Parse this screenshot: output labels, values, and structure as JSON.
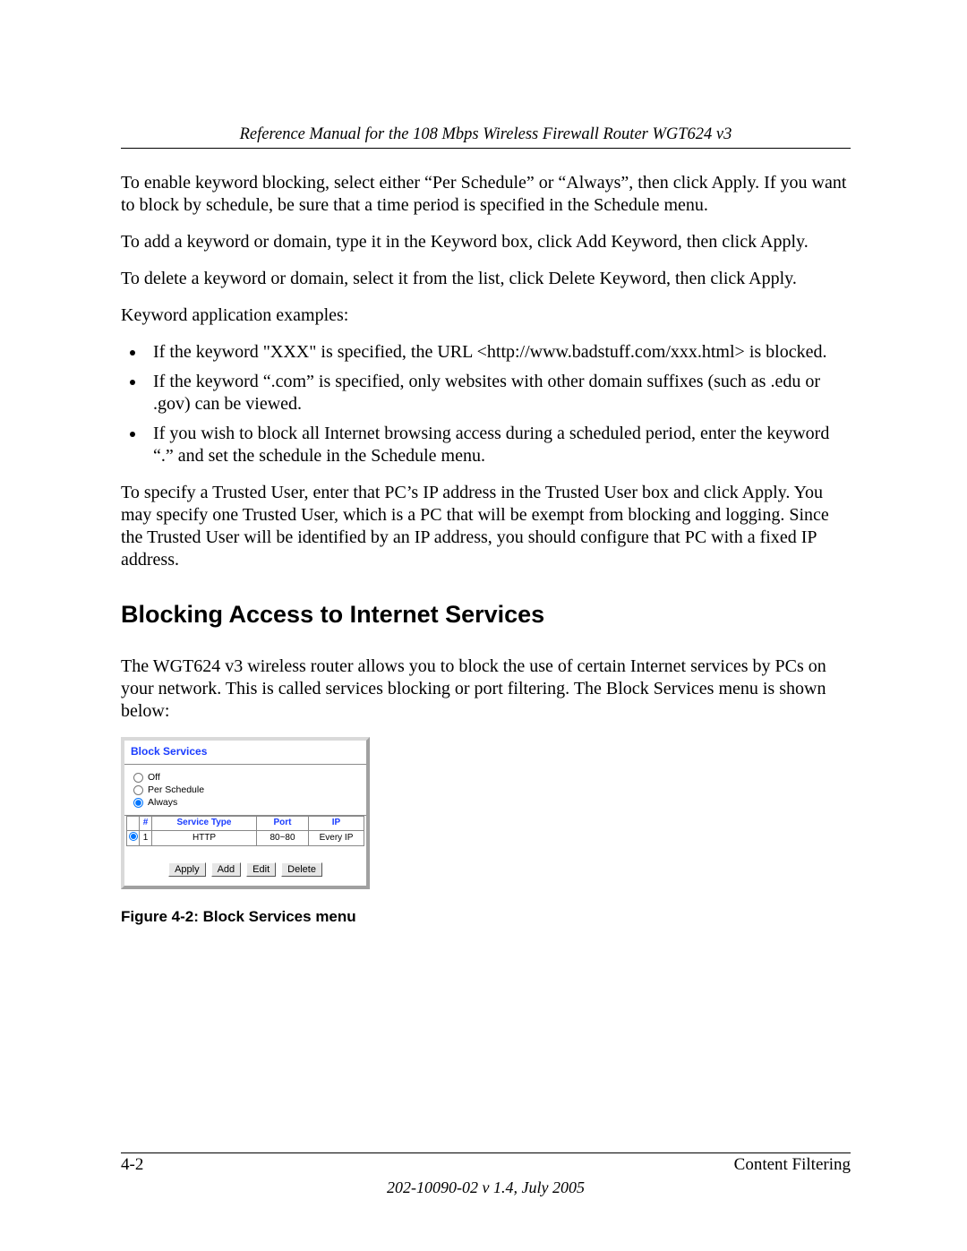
{
  "header": {
    "title": "Reference Manual for the 108 Mbps Wireless Firewall Router WGT624 v3"
  },
  "paragraphs": {
    "p1": "To enable keyword blocking, select either “Per Schedule” or “Always”, then click Apply. If you want to block by schedule, be sure that a time period is specified in the Schedule menu.",
    "p2": "To add a keyword or domain, type it in the Keyword box, click Add Keyword, then click Apply.",
    "p3": "To delete a keyword or domain, select it from the list, click Delete Keyword, then click Apply.",
    "p4": "Keyword application examples:",
    "p5": "To specify a Trusted User, enter that PC’s IP address in the Trusted User box and click Apply. You may specify one Trusted User, which is a PC that will be exempt from blocking and logging. Since the Trusted User will be identified by an IP address, you should configure that PC with a fixed IP address."
  },
  "bullets": {
    "b1": "If the keyword \"XXX\" is specified, the URL <http://www.badstuff.com/xxx.html> is blocked.",
    "b2": "If the keyword “.com” is specified, only websites with other domain suffixes (such as .edu or .gov) can be viewed.",
    "b3": "If you wish to block all Internet browsing access during a scheduled period, enter the keyword “.” and set the schedule in the Schedule menu."
  },
  "section": {
    "heading": "Blocking Access to Internet Services",
    "intro": "The WGT624 v3 wireless router allows you to block the use of certain Internet services by PCs on your network. This is called services blocking or port filtering. The Block Services menu is shown below:"
  },
  "block_services": {
    "title": "Block Services",
    "radios": {
      "off": "Off",
      "per_schedule": "Per Schedule",
      "always": "Always"
    },
    "table": {
      "headers": {
        "num": "#",
        "service_type": "Service Type",
        "port": "Port",
        "ip": "IP"
      },
      "row1": {
        "num": "1",
        "service_type": "HTTP",
        "port": "80~80",
        "ip": "Every IP"
      }
    },
    "buttons": {
      "apply": "Apply",
      "add": "Add",
      "edit": "Edit",
      "delete": "Delete"
    }
  },
  "figure": {
    "caption": "Figure 4-2:  Block Services menu"
  },
  "footer": {
    "page_num": "4-2",
    "section": "Content Filtering",
    "pub": "202-10090-02 v 1.4, July 2005"
  }
}
